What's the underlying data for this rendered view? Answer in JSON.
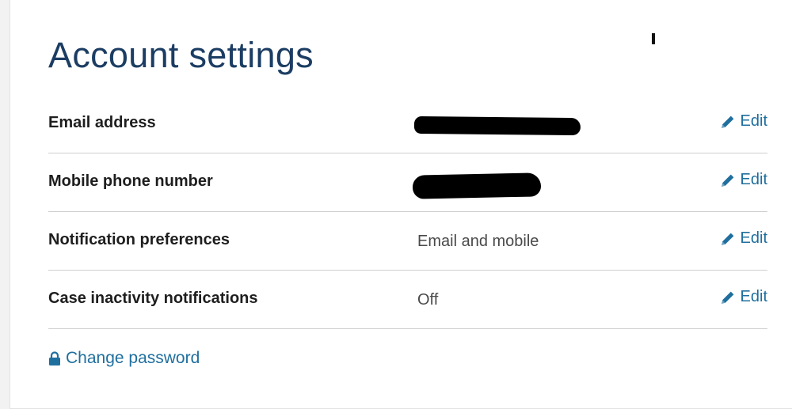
{
  "page": {
    "title": "Account settings"
  },
  "settings": [
    {
      "label": "Email address",
      "value": "",
      "value_redacted": true,
      "edit_label": "Edit"
    },
    {
      "label": "Mobile phone number",
      "value": "",
      "value_redacted": true,
      "edit_label": "Edit"
    },
    {
      "label": "Notification preferences",
      "value": "Email and mobile",
      "value_redacted": false,
      "edit_label": "Edit"
    },
    {
      "label": "Case inactivity notifications",
      "value": "Off",
      "value_redacted": false,
      "edit_label": "Edit"
    }
  ],
  "actions": {
    "change_password_label": "Change password"
  },
  "icons": {
    "edit": "pencil-icon",
    "change_password": "lock-icon"
  },
  "colors": {
    "title": "#1c3d63",
    "link": "#1f6f9e",
    "label": "#1e1e1e",
    "value": "#4a4a4a",
    "divider": "#cfcfcf"
  }
}
